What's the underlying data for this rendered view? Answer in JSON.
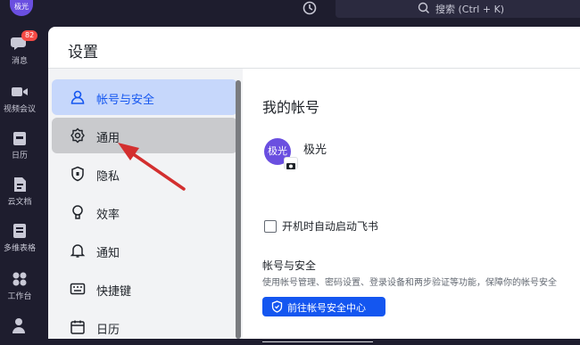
{
  "rail": {
    "avatar": "极光",
    "items": [
      {
        "label": "消息",
        "badge": "82",
        "icon": "chat-icon"
      },
      {
        "label": "视频会议",
        "icon": "video-icon"
      },
      {
        "label": "日历",
        "icon": "calendar-icon"
      },
      {
        "label": "云文档",
        "icon": "document-icon"
      },
      {
        "label": "多维表格",
        "icon": "table-icon"
      },
      {
        "label": "工作台",
        "icon": "grid-icon"
      }
    ]
  },
  "topbar": {
    "search_placeholder": "搜索 (Ctrl + K)"
  },
  "settings": {
    "title": "设置",
    "nav": [
      {
        "label": "帐号与安全",
        "icon": "user-icon"
      },
      {
        "label": "通用",
        "icon": "gear-icon"
      },
      {
        "label": "隐私",
        "icon": "shield-icon"
      },
      {
        "label": "效率",
        "icon": "bulb-icon"
      },
      {
        "label": "通知",
        "icon": "bell-icon"
      },
      {
        "label": "快捷键",
        "icon": "keyboard-icon"
      },
      {
        "label": "日历",
        "icon": "calendar-icon"
      }
    ],
    "content": {
      "title": "我的帐号",
      "avatar_text": "极光",
      "username": "极光",
      "autostart_label": "开机时自动启动飞书",
      "autostart_checked": false,
      "security_title": "帐号与安全",
      "security_desc": "使用帐号管理、密码设置、登录设备和两步验证等功能，保障你的帐号安全",
      "security_button": "前往帐号安全中心"
    }
  },
  "colors": {
    "accent": "#1456f0",
    "avatar": "#6a4fe0",
    "badge": "#f54a45",
    "arrow": "#d32f2f"
  }
}
